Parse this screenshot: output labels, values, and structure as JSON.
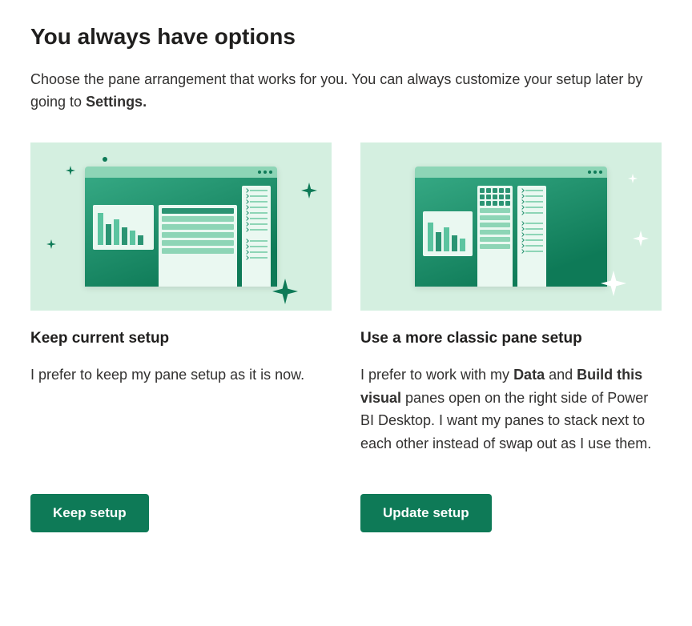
{
  "header": {
    "title": "You always have options",
    "description_pre": "Choose the pane arrangement that works for you. You can always customize your setup later by going to ",
    "description_bold": "Settings."
  },
  "options": {
    "left": {
      "title": "Keep current setup",
      "description": "I prefer to keep my pane setup as it is now.",
      "button_label": "Keep setup"
    },
    "right": {
      "title": "Use a more classic pane setup",
      "desc_parts": {
        "p1": "I prefer to work with my ",
        "b1": "Data",
        "p2": " and ",
        "b2": "Build this visual",
        "p3": " panes open on the right side of Power BI Desktop. I want my panes to stack next to each other instead of swap out as I use them."
      },
      "button_label": "Update setup"
    }
  },
  "colors": {
    "accent": "#0e7a57",
    "illustration_bg": "#d4efe0"
  }
}
